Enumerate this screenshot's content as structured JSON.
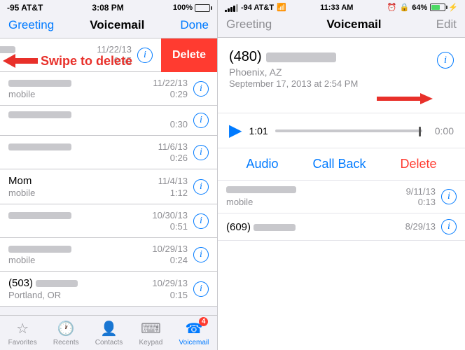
{
  "left": {
    "statusBar": {
      "carrier": "-95 AT&T",
      "signal": "●●●○○",
      "time": "3:08 PM",
      "battery": "100%"
    },
    "navBar": {
      "greeting": "Greeting",
      "title": "Voicemail",
      "done": "Done"
    },
    "swipeLabel": "Swipe to delete",
    "rows": [
      {
        "name": "",
        "sub": "mobile",
        "date": "11/22/13",
        "duration": "0:45",
        "blurred": true,
        "swiped": true
      },
      {
        "name": "",
        "sub": "mobile",
        "date": "11/22/13",
        "duration": "0:29",
        "blurred": true,
        "swiped": false
      },
      {
        "name": "",
        "sub": "",
        "date": "",
        "duration": "0:30",
        "blurred": true,
        "swiped": false
      },
      {
        "name": "",
        "sub": "",
        "date": "11/6/13",
        "duration": "0:26",
        "blurred": true,
        "swiped": false
      },
      {
        "name": "Mom",
        "sub": "mobile",
        "date": "11/4/13",
        "duration": "1:12",
        "blurred": false,
        "swiped": false
      },
      {
        "name": "",
        "sub": "",
        "date": "10/30/13",
        "duration": "0:51",
        "blurred": true,
        "swiped": false
      },
      {
        "name": "",
        "sub": "mobile",
        "date": "10/29/13",
        "duration": "0:24",
        "blurred": true,
        "swiped": false
      },
      {
        "name": "(503)",
        "sub": "Portland, OR",
        "date": "10/29/13",
        "duration": "0:15",
        "blurred": false,
        "swiped": false
      }
    ],
    "tabBar": {
      "items": [
        {
          "label": "Favorites",
          "icon": "★",
          "active": false
        },
        {
          "label": "Recents",
          "icon": "🕐",
          "active": false
        },
        {
          "label": "Contacts",
          "icon": "👤",
          "active": false
        },
        {
          "label": "Keypad",
          "icon": "⌨",
          "active": false
        },
        {
          "label": "Voicemail",
          "icon": "☎",
          "active": true,
          "badge": "4"
        }
      ]
    },
    "deleteLabel": "Delete"
  },
  "right": {
    "statusBar": {
      "carrier": "-94 AT&T",
      "time": "11:33 AM",
      "battery": "64%"
    },
    "navBar": {
      "greeting": "Greeting",
      "title": "Voicemail",
      "edit": "Edit"
    },
    "detail": {
      "callerPrefix": "(480)",
      "callerLocation": "Phoenix, AZ",
      "callerDate": "September 17, 2013 at 2:54 PM",
      "playerTime": "1:01",
      "playerRemaining": "0:00",
      "actions": {
        "audio": "Audio",
        "callBack": "Call Back",
        "delete": "Delete"
      }
    },
    "miniRows": [
      {
        "name": "",
        "sub": "mobile",
        "date": "9/11/13",
        "duration": "0:13",
        "blurred": true
      },
      {
        "name": "(609)",
        "sub": "",
        "date": "8/29/13",
        "duration": "",
        "blurred": false
      }
    ]
  }
}
